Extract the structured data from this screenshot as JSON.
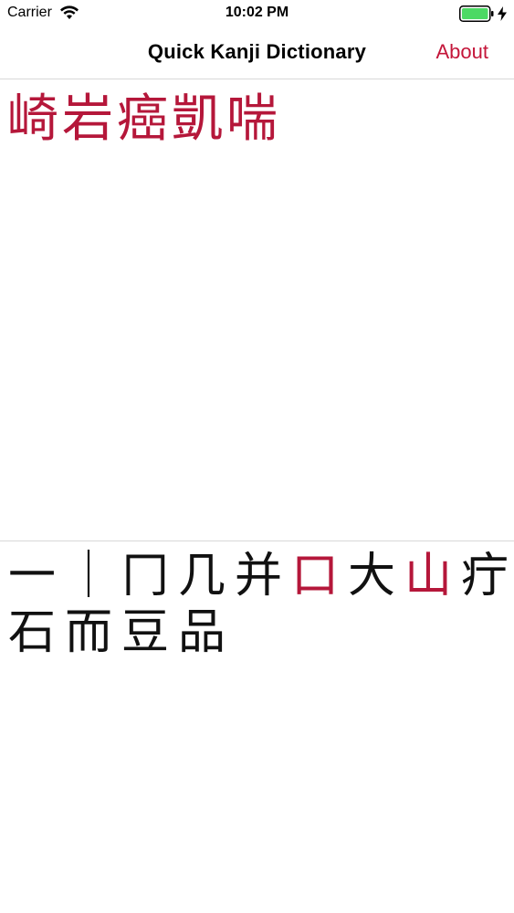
{
  "status_bar": {
    "carrier": "Carrier",
    "time": "10:02 PM"
  },
  "nav": {
    "title": "Quick Kanji Dictionary",
    "about_label": "About"
  },
  "colors": {
    "accent": "#c4163a",
    "battery": "#4cd964"
  },
  "results": [
    {
      "char": "崎"
    },
    {
      "char": "岩"
    },
    {
      "char": "癌"
    },
    {
      "char": "凱"
    },
    {
      "char": "喘"
    }
  ],
  "radicals": [
    {
      "char": "一",
      "selected": false
    },
    {
      "char": "｜",
      "selected": false
    },
    {
      "char": "冂",
      "selected": false
    },
    {
      "char": "几",
      "selected": false
    },
    {
      "char": "并",
      "selected": false
    },
    {
      "char": "口",
      "selected": true
    },
    {
      "char": "大",
      "selected": false
    },
    {
      "char": "山",
      "selected": true
    },
    {
      "char": "疔",
      "selected": false
    },
    {
      "char": "石",
      "selected": false
    },
    {
      "char": "而",
      "selected": false
    },
    {
      "char": "豆",
      "selected": false
    },
    {
      "char": "品",
      "selected": false
    }
  ]
}
